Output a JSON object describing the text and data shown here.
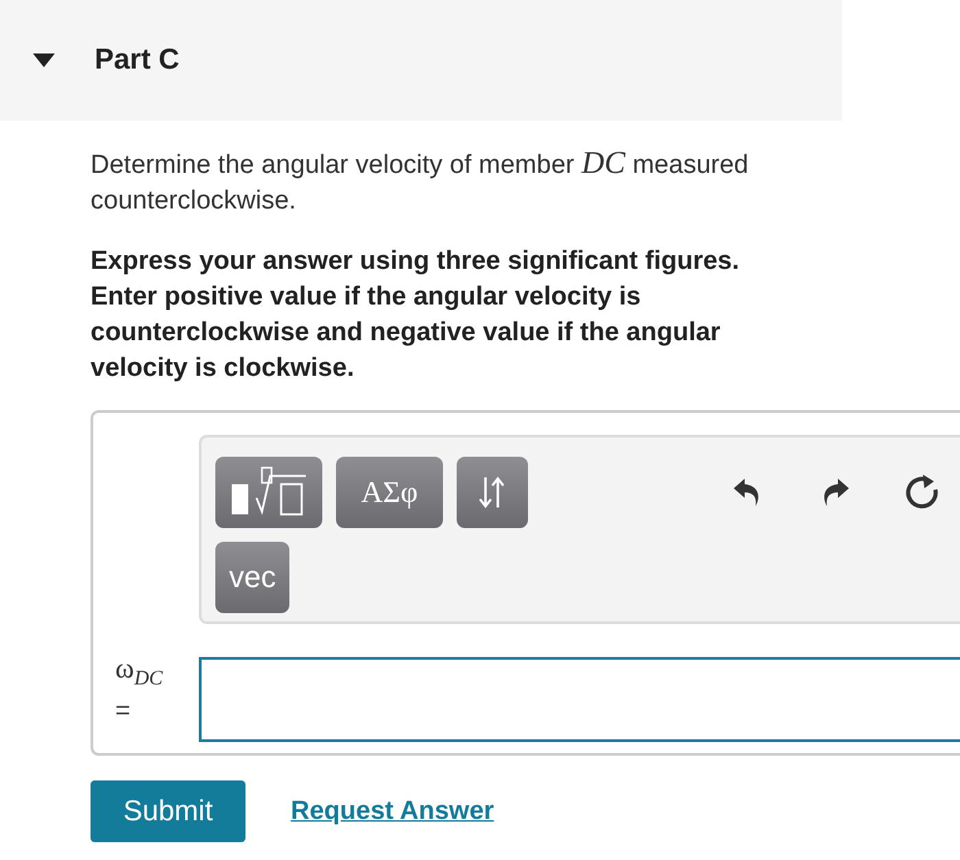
{
  "part": {
    "title": "Part C",
    "expanded": true
  },
  "question": "Determine the angular velocity of member *DC* measured counterclockwise.",
  "instructions": "Express your answer using three significant figures. Enter positive value if the angular velocity is counterclockwise and negative value if the angular velocity is clockwise.",
  "toolbar": {
    "buttons": [
      {
        "kind": "template"
      },
      {
        "kind": "text",
        "label": "ΑΣφ"
      },
      {
        "kind": "arrows"
      },
      {
        "kind": "text",
        "label": "vec"
      }
    ],
    "actions": [
      {
        "kind": "undo"
      },
      {
        "kind": "redo"
      },
      {
        "kind": "reset"
      }
    ]
  },
  "answer": {
    "label": "ω$_{DC}$",
    "equals": "="
  },
  "buttons": {
    "submit": "Submit",
    "request": "Request Answer"
  }
}
